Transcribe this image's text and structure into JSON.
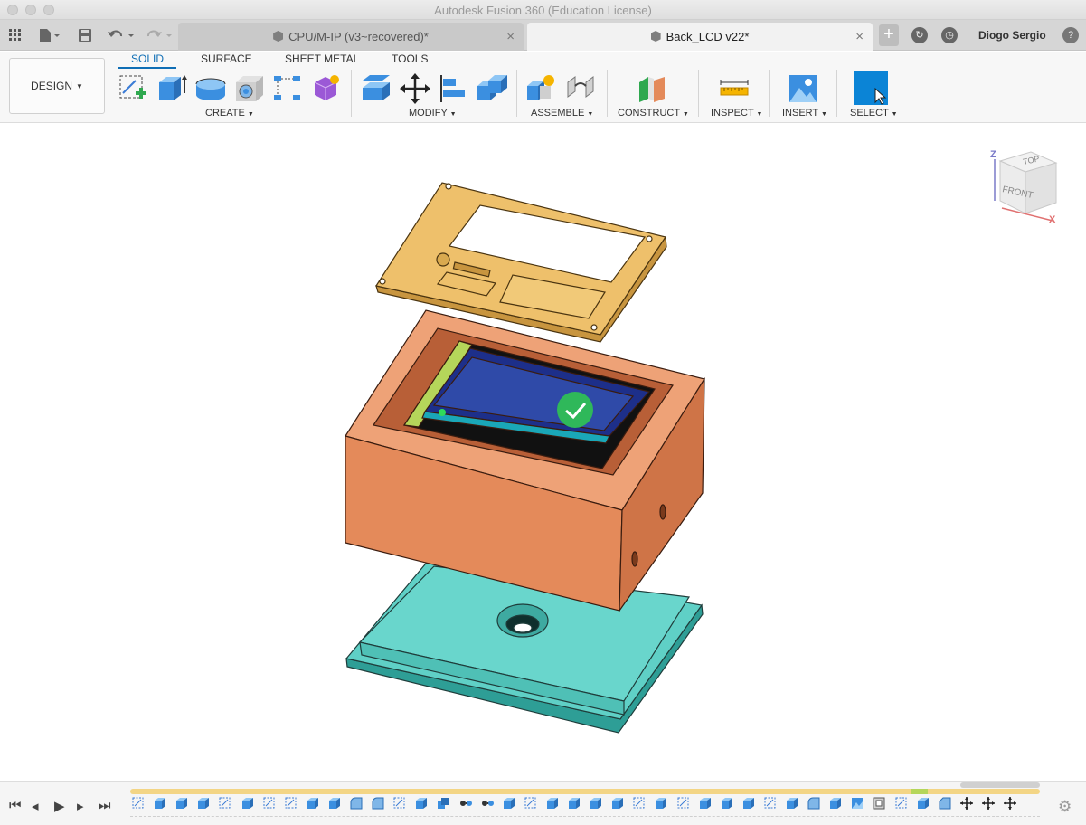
{
  "window": {
    "title": "Autodesk Fusion 360 (Education License)"
  },
  "tabs": [
    {
      "label": "CPU/M-IP (v3~recovered)*",
      "close": "×"
    },
    {
      "label": "Back_LCD v22*",
      "close": "×"
    }
  ],
  "user": {
    "name": "Diogo Sergio"
  },
  "help": "?",
  "workspace": {
    "label": "DESIGN"
  },
  "workspace_tabs": [
    "SOLID",
    "SURFACE",
    "SHEET METAL",
    "TOOLS"
  ],
  "groups": {
    "create": "CREATE",
    "modify": "MODIFY",
    "assemble": "ASSEMBLE",
    "construct": "CONSTRUCT",
    "inspect": "INSPECT",
    "insert": "INSERT",
    "select": "SELECT"
  },
  "viewcube": {
    "top": "TOP",
    "front": "FRONT",
    "z": "Z",
    "x": "X"
  },
  "colors": {
    "accent": "#0f6eb5",
    "lid": "#eec06b",
    "body": "#e48a5a",
    "base": "#5fd0c6",
    "timeline": "#f3d585"
  },
  "timeline_features": [
    "sketch",
    "extrude",
    "extrude",
    "extrude",
    "sketch",
    "extrude",
    "sketch",
    "sketch",
    "extrude",
    "extrude",
    "fillet",
    "fillet",
    "sketch",
    "extrude",
    "combine",
    "joint",
    "joint",
    "extrude",
    "sketch",
    "extrude",
    "extrude",
    "extrude",
    "extrude",
    "sketch",
    "extrude",
    "sketch",
    "extrude",
    "extrude",
    "extrude",
    "sketch",
    "extrude",
    "fillet",
    "extrude",
    "decal",
    "shell",
    "sketch",
    "extrude",
    "chamfer",
    "move",
    "move",
    "move"
  ]
}
